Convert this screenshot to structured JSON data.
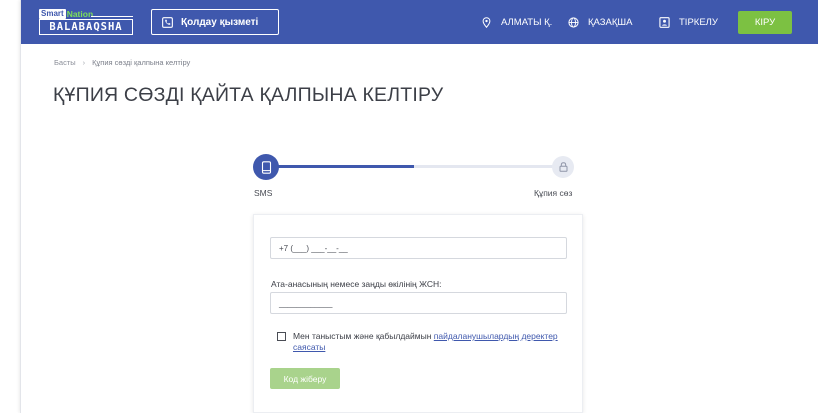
{
  "header": {
    "logo_small": "Smart",
    "logo_accent": "Nation",
    "logo_main": "BALABAQSHA",
    "support_label": "Қолдау қызметі",
    "city_label": "АЛМАТЫ Қ.",
    "language_label": "ҚАЗАҚША",
    "register_label": "ТІРКЕЛУ",
    "login_label": "КІРУ"
  },
  "breadcrumb": {
    "home": "Басты",
    "separator": "›",
    "current": "Құпия сөзді қалпына келтіру"
  },
  "page_title": "ҚҰПИЯ СӨЗДІ ҚАЙТА ҚАЛПЫНА КЕЛТІРУ",
  "stepper": {
    "steps": [
      {
        "label": "SMS",
        "icon": "phone-icon",
        "state": "active"
      },
      {
        "label": "Құпия сөз",
        "icon": "lock-icon",
        "state": "inactive"
      }
    ]
  },
  "form": {
    "phone_value": "+7 (___) ___-__-__",
    "iin_label": "Ата-анасының немесе заңды өкілінің ЖСН:",
    "iin_value": "____________",
    "consent_text": "Мен таныстым және қабылдаймын ",
    "consent_link": "пайдаланушылардың деректер саясаты",
    "consent_checked": false,
    "submit_label": "Код жіберу"
  },
  "colors": {
    "header_bg": "#3f58ad",
    "accent_green": "#7cc142",
    "disabled_green": "#a9d38c",
    "step_active": "#3f58ad",
    "step_inactive": "#e7eaf2"
  }
}
